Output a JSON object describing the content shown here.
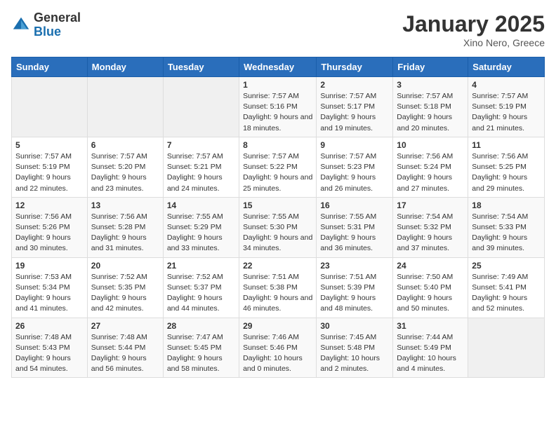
{
  "header": {
    "logo_general": "General",
    "logo_blue": "Blue",
    "month_title": "January 2025",
    "location": "Xino Nero, Greece"
  },
  "weekdays": [
    "Sunday",
    "Monday",
    "Tuesday",
    "Wednesday",
    "Thursday",
    "Friday",
    "Saturday"
  ],
  "weeks": [
    [
      {
        "day": "",
        "sunrise": "",
        "sunset": "",
        "daylight": ""
      },
      {
        "day": "",
        "sunrise": "",
        "sunset": "",
        "daylight": ""
      },
      {
        "day": "",
        "sunrise": "",
        "sunset": "",
        "daylight": ""
      },
      {
        "day": "1",
        "sunrise": "Sunrise: 7:57 AM",
        "sunset": "Sunset: 5:16 PM",
        "daylight": "Daylight: 9 hours and 18 minutes."
      },
      {
        "day": "2",
        "sunrise": "Sunrise: 7:57 AM",
        "sunset": "Sunset: 5:17 PM",
        "daylight": "Daylight: 9 hours and 19 minutes."
      },
      {
        "day": "3",
        "sunrise": "Sunrise: 7:57 AM",
        "sunset": "Sunset: 5:18 PM",
        "daylight": "Daylight: 9 hours and 20 minutes."
      },
      {
        "day": "4",
        "sunrise": "Sunrise: 7:57 AM",
        "sunset": "Sunset: 5:19 PM",
        "daylight": "Daylight: 9 hours and 21 minutes."
      }
    ],
    [
      {
        "day": "5",
        "sunrise": "Sunrise: 7:57 AM",
        "sunset": "Sunset: 5:19 PM",
        "daylight": "Daylight: 9 hours and 22 minutes."
      },
      {
        "day": "6",
        "sunrise": "Sunrise: 7:57 AM",
        "sunset": "Sunset: 5:20 PM",
        "daylight": "Daylight: 9 hours and 23 minutes."
      },
      {
        "day": "7",
        "sunrise": "Sunrise: 7:57 AM",
        "sunset": "Sunset: 5:21 PM",
        "daylight": "Daylight: 9 hours and 24 minutes."
      },
      {
        "day": "8",
        "sunrise": "Sunrise: 7:57 AM",
        "sunset": "Sunset: 5:22 PM",
        "daylight": "Daylight: 9 hours and 25 minutes."
      },
      {
        "day": "9",
        "sunrise": "Sunrise: 7:57 AM",
        "sunset": "Sunset: 5:23 PM",
        "daylight": "Daylight: 9 hours and 26 minutes."
      },
      {
        "day": "10",
        "sunrise": "Sunrise: 7:56 AM",
        "sunset": "Sunset: 5:24 PM",
        "daylight": "Daylight: 9 hours and 27 minutes."
      },
      {
        "day": "11",
        "sunrise": "Sunrise: 7:56 AM",
        "sunset": "Sunset: 5:25 PM",
        "daylight": "Daylight: 9 hours and 29 minutes."
      }
    ],
    [
      {
        "day": "12",
        "sunrise": "Sunrise: 7:56 AM",
        "sunset": "Sunset: 5:26 PM",
        "daylight": "Daylight: 9 hours and 30 minutes."
      },
      {
        "day": "13",
        "sunrise": "Sunrise: 7:56 AM",
        "sunset": "Sunset: 5:28 PM",
        "daylight": "Daylight: 9 hours and 31 minutes."
      },
      {
        "day": "14",
        "sunrise": "Sunrise: 7:55 AM",
        "sunset": "Sunset: 5:29 PM",
        "daylight": "Daylight: 9 hours and 33 minutes."
      },
      {
        "day": "15",
        "sunrise": "Sunrise: 7:55 AM",
        "sunset": "Sunset: 5:30 PM",
        "daylight": "Daylight: 9 hours and 34 minutes."
      },
      {
        "day": "16",
        "sunrise": "Sunrise: 7:55 AM",
        "sunset": "Sunset: 5:31 PM",
        "daylight": "Daylight: 9 hours and 36 minutes."
      },
      {
        "day": "17",
        "sunrise": "Sunrise: 7:54 AM",
        "sunset": "Sunset: 5:32 PM",
        "daylight": "Daylight: 9 hours and 37 minutes."
      },
      {
        "day": "18",
        "sunrise": "Sunrise: 7:54 AM",
        "sunset": "Sunset: 5:33 PM",
        "daylight": "Daylight: 9 hours and 39 minutes."
      }
    ],
    [
      {
        "day": "19",
        "sunrise": "Sunrise: 7:53 AM",
        "sunset": "Sunset: 5:34 PM",
        "daylight": "Daylight: 9 hours and 41 minutes."
      },
      {
        "day": "20",
        "sunrise": "Sunrise: 7:52 AM",
        "sunset": "Sunset: 5:35 PM",
        "daylight": "Daylight: 9 hours and 42 minutes."
      },
      {
        "day": "21",
        "sunrise": "Sunrise: 7:52 AM",
        "sunset": "Sunset: 5:37 PM",
        "daylight": "Daylight: 9 hours and 44 minutes."
      },
      {
        "day": "22",
        "sunrise": "Sunrise: 7:51 AM",
        "sunset": "Sunset: 5:38 PM",
        "daylight": "Daylight: 9 hours and 46 minutes."
      },
      {
        "day": "23",
        "sunrise": "Sunrise: 7:51 AM",
        "sunset": "Sunset: 5:39 PM",
        "daylight": "Daylight: 9 hours and 48 minutes."
      },
      {
        "day": "24",
        "sunrise": "Sunrise: 7:50 AM",
        "sunset": "Sunset: 5:40 PM",
        "daylight": "Daylight: 9 hours and 50 minutes."
      },
      {
        "day": "25",
        "sunrise": "Sunrise: 7:49 AM",
        "sunset": "Sunset: 5:41 PM",
        "daylight": "Daylight: 9 hours and 52 minutes."
      }
    ],
    [
      {
        "day": "26",
        "sunrise": "Sunrise: 7:48 AM",
        "sunset": "Sunset: 5:43 PM",
        "daylight": "Daylight: 9 hours and 54 minutes."
      },
      {
        "day": "27",
        "sunrise": "Sunrise: 7:48 AM",
        "sunset": "Sunset: 5:44 PM",
        "daylight": "Daylight: 9 hours and 56 minutes."
      },
      {
        "day": "28",
        "sunrise": "Sunrise: 7:47 AM",
        "sunset": "Sunset: 5:45 PM",
        "daylight": "Daylight: 9 hours and 58 minutes."
      },
      {
        "day": "29",
        "sunrise": "Sunrise: 7:46 AM",
        "sunset": "Sunset: 5:46 PM",
        "daylight": "Daylight: 10 hours and 0 minutes."
      },
      {
        "day": "30",
        "sunrise": "Sunrise: 7:45 AM",
        "sunset": "Sunset: 5:48 PM",
        "daylight": "Daylight: 10 hours and 2 minutes."
      },
      {
        "day": "31",
        "sunrise": "Sunrise: 7:44 AM",
        "sunset": "Sunset: 5:49 PM",
        "daylight": "Daylight: 10 hours and 4 minutes."
      },
      {
        "day": "",
        "sunrise": "",
        "sunset": "",
        "daylight": ""
      }
    ]
  ]
}
